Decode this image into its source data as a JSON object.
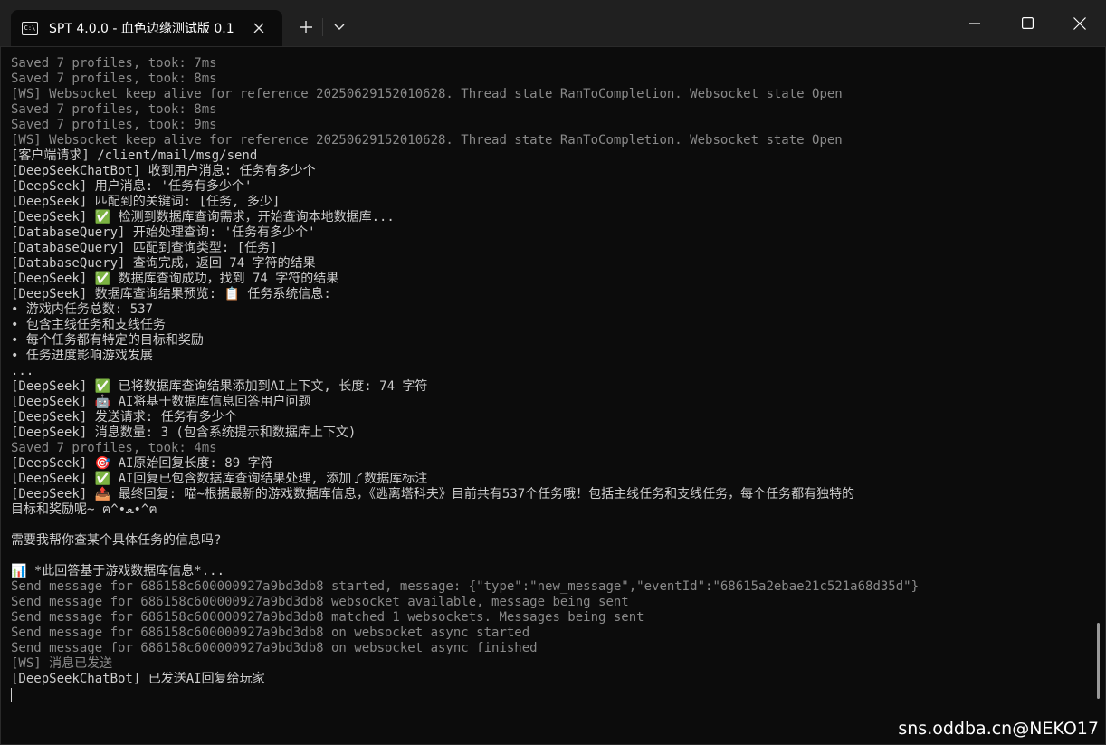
{
  "window": {
    "tab_title": "SPT 4.0.0 - 血色边缘测试版 0.1",
    "tab_icon_text": "C:\\",
    "new_tab": "+",
    "tab_close": "✕",
    "dropdown": "⌄"
  },
  "terminal": {
    "lines": [
      {
        "text": "Saved 7 profiles, took: 7ms",
        "dim": true
      },
      {
        "text": "Saved 7 profiles, took: 8ms",
        "dim": true
      },
      {
        "text": "[WS] Websocket keep alive for reference 20250629152010628. Thread state RanToCompletion. Websocket state Open",
        "dim": true
      },
      {
        "text": "Saved 7 profiles, took: 8ms",
        "dim": true
      },
      {
        "text": "Saved 7 profiles, took: 9ms",
        "dim": true
      },
      {
        "text": "[WS] Websocket keep alive for reference 20250629152010628. Thread state RanToCompletion. Websocket state Open",
        "dim": true
      },
      {
        "text": "[客户端请求] /client/mail/msg/send",
        "dim": false
      },
      {
        "text": "[DeepSeekChatBot] 收到用户消息: 任务有多少个",
        "dim": false
      },
      {
        "text": "[DeepSeek] 用户消息: '任务有多少个'",
        "dim": false
      },
      {
        "text": "[DeepSeek] 匹配到的关键词: [任务, 多少]",
        "dim": false
      },
      {
        "text": "[DeepSeek] ✅ 检测到数据库查询需求，开始查询本地数据库...",
        "dim": false
      },
      {
        "text": "[DatabaseQuery] 开始处理查询: '任务有多少个'",
        "dim": false
      },
      {
        "text": "[DatabaseQuery] 匹配到查询类型: [任务]",
        "dim": false
      },
      {
        "text": "[DatabaseQuery] 查询完成，返回 74 字符的结果",
        "dim": false
      },
      {
        "text": "[DeepSeek] ✅ 数据库查询成功，找到 74 字符的结果",
        "dim": false
      },
      {
        "text": "[DeepSeek] 数据库查询结果预览: 📋 任务系统信息:",
        "dim": false
      },
      {
        "text": "• 游戏内任务总数: 537",
        "dim": false
      },
      {
        "text": "• 包含主线任务和支线任务",
        "dim": false
      },
      {
        "text": "• 每个任务都有特定的目标和奖励",
        "dim": false
      },
      {
        "text": "• 任务进度影响游戏发展",
        "dim": false
      },
      {
        "text": "...",
        "dim": false
      },
      {
        "text": "[DeepSeek] ✅ 已将数据库查询结果添加到AI上下文, 长度: 74 字符",
        "dim": false
      },
      {
        "text": "[DeepSeek] 🤖 AI将基于数据库信息回答用户问题",
        "dim": false
      },
      {
        "text": "[DeepSeek] 发送请求: 任务有多少个",
        "dim": false
      },
      {
        "text": "[DeepSeek] 消息数量: 3 (包含系统提示和数据库上下文)",
        "dim": false
      },
      {
        "text": "Saved 7 profiles, took: 4ms",
        "dim": true
      },
      {
        "text": "[DeepSeek] 🎯 AI原始回复长度: 89 字符",
        "dim": false
      },
      {
        "text": "[DeepSeek] ✅ AI回复已包含数据库查询结果处理, 添加了数据库标注",
        "dim": false
      },
      {
        "text": "[DeepSeek] 📤 最终回复: 喵~根据最新的游戏数据库信息，《逃离塔科夫》目前共有537个任务哦！包括主线任务和支线任务，每个任务都有独特的",
        "dim": false
      },
      {
        "text": "目标和奖励呢~ ฅ^•ﻌ•^ฅ",
        "dim": false
      },
      {
        "text": "",
        "dim": false
      },
      {
        "text": "需要我帮你查某个具体任务的信息吗?",
        "dim": false
      },
      {
        "text": "",
        "dim": false
      },
      {
        "text": "📊 *此回答基于游戏数据库信息*...",
        "dim": false
      },
      {
        "text": "Send message for 686158c600000927a9bd3db8 started, message: {\"type\":\"new_message\",\"eventId\":\"68615a2ebae21c521a68d35d\"}",
        "dim": true
      },
      {
        "text": "Send message for 686158c600000927a9bd3db8 websocket available, message being sent",
        "dim": true
      },
      {
        "text": "Send message for 686158c600000927a9bd3db8 matched 1 websockets. Messages being sent",
        "dim": true
      },
      {
        "text": "Send message for 686158c600000927a9bd3db8 on websocket async started",
        "dim": true
      },
      {
        "text": "Send message for 686158c600000927a9bd3db8 on websocket async finished",
        "dim": true
      },
      {
        "text": "[WS] 消息已发送",
        "dim": true
      },
      {
        "text": "[DeepSeekChatBot] 已发送AI回复给玩家",
        "dim": false
      }
    ]
  },
  "watermark": "sns.oddba.cn@NEKO17"
}
